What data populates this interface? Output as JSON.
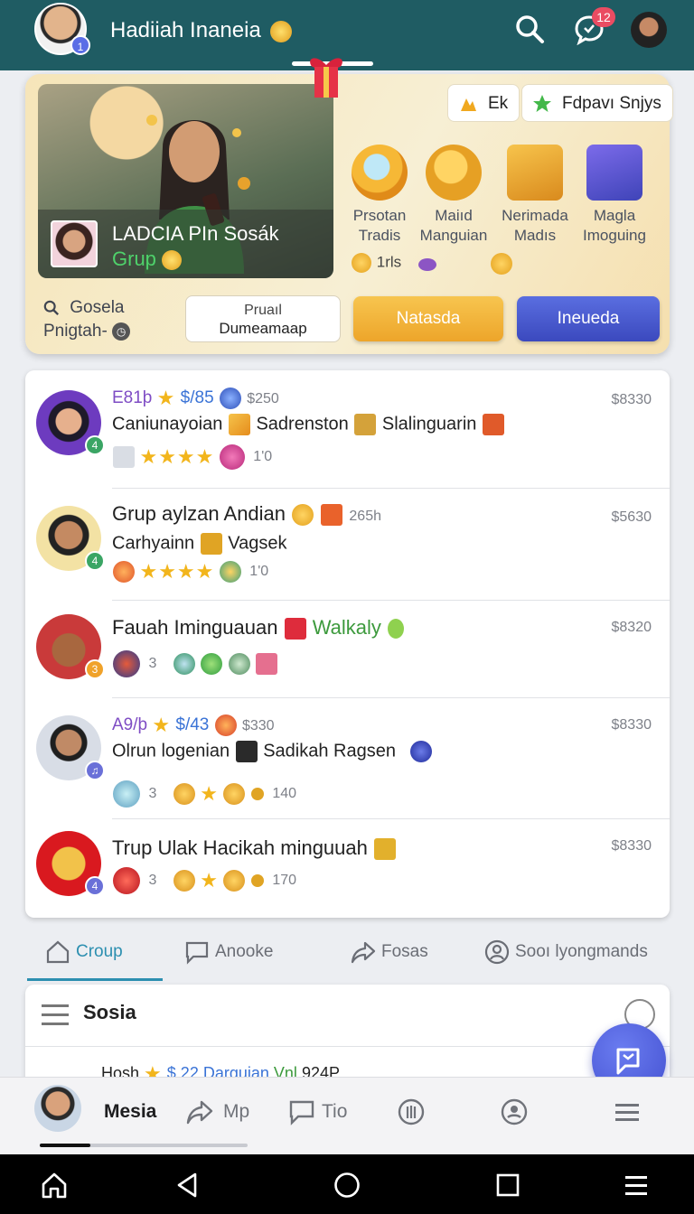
{
  "header": {
    "title": "Hadiiah Inaneia",
    "notification_count": "12"
  },
  "promo": {
    "hero_title": "LADCIA PIn Sosák",
    "hero_subtitle": "Grup",
    "chip1": "Ek",
    "chip2": "Fdpavı Snjys",
    "rewards": [
      {
        "label1": "Prsotan",
        "label2": "Tradis"
      },
      {
        "label1": "Maiıd",
        "label2": "Manguian"
      },
      {
        "label1": "Nerimada",
        "label2": "Madıs"
      },
      {
        "label1": "Magla",
        "label2": "Imoguing"
      }
    ],
    "reward_extra": "1rls",
    "search_line1": "Gosela",
    "search_line2": "Pnigtah-",
    "button_white_l1": "Pruaıl",
    "button_white_l2": "Dumeamaap",
    "button_orange": "Natasda",
    "button_purple": "Ineueda"
  },
  "groups": [
    {
      "meta_name": "E81þ",
      "meta_price": "$/85",
      "meta_amount": "$250",
      "title": "Caniunayoian",
      "title2": "Sadrenston",
      "title3": "Slalinguarin",
      "stars": 4,
      "count": "1'0",
      "price": "$8330",
      "level": "4"
    },
    {
      "title": "Grup aylzan Andian",
      "meta_time": "265h",
      "subtitle": "Carhyainn",
      "subtitle2": "Vagsek",
      "stars": 4,
      "count": "1'0",
      "price": "$5630",
      "level": "4"
    },
    {
      "title": "Fauah Iminguauan",
      "title_green": "Walkaly",
      "count": "3",
      "price": "$8320",
      "level": "3"
    },
    {
      "meta_name": "A9/þ",
      "meta_price": "$/43",
      "meta_amount": "$330",
      "subtitle": "Olrun logenian",
      "subtitle2": "Sadikah Ragsen",
      "count": "3",
      "count2": "140",
      "price": "$8330",
      "level": "♫"
    },
    {
      "title": "Trup Ulak Hacikah minguuah",
      "count": "3",
      "count2": "170",
      "price": "$8330",
      "level": "4"
    }
  ],
  "tabs": [
    {
      "label": "Croup"
    },
    {
      "label": "Anooke"
    },
    {
      "label": "Fosas"
    },
    {
      "label": "Sooı lyongmands"
    }
  ],
  "sosia": {
    "title": "Sosia",
    "peek_name": "Hosh",
    "peek_blue": "$.22 Darguian",
    "peek_green": "Vnl",
    "peek_meta": "924P"
  },
  "bottom_nav": [
    {
      "label": "Mesia"
    },
    {
      "label": "Mp"
    },
    {
      "label": "Tio"
    }
  ],
  "colors": {
    "header_bg": "#1f5c63",
    "accent_teal": "#2c8fb0",
    "accent_purple": "#4451d1",
    "accent_orange": "#eda52a"
  }
}
